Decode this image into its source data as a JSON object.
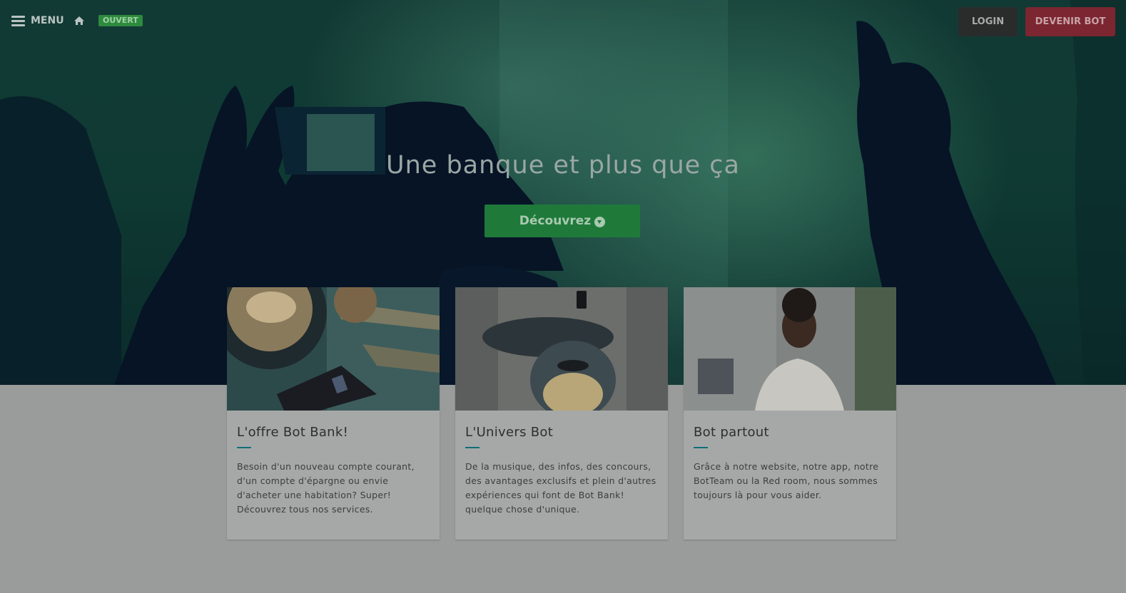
{
  "header": {
    "menu_label": "MENU",
    "status_badge": "OUVERT",
    "login_label": "LOGIN",
    "signup_label": "DEVENIR BOT"
  },
  "hero": {
    "title": "Une banque et plus que ça",
    "cta_label": "Découvrez"
  },
  "cards": [
    {
      "title": "L'offre Bot Bank!",
      "text": "Besoin d'un nouveau compte courant, d'un compte d'épargne ou envie d'acheter une habitation? Super! Découvrez tous nos services."
    },
    {
      "title": "L'Univers Bot",
      "text": "De la musique, des infos, des concours, des avantages exclusifs et plein d'autres expériences qui font de Bot Bank! quelque chose d'unique."
    },
    {
      "title": "Bot partout",
      "text": "Grâce à notre website, notre app, notre BotTeam ou la Red room, nous sommes toujours là pour vous aider."
    }
  ],
  "icons": {
    "menu": "hamburger-icon",
    "home": "home-icon",
    "cta": "chevron-down-circle-icon"
  },
  "colors": {
    "cta_green": "#1f7a3a",
    "signup_red": "#7b2630",
    "accent_teal": "#0e6f78"
  }
}
